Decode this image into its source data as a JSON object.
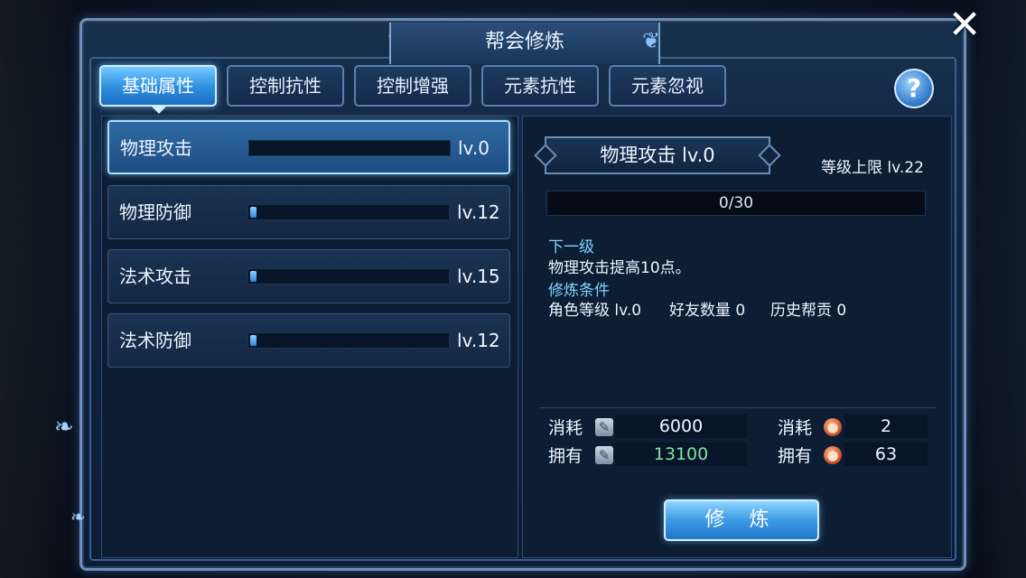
{
  "dialog": {
    "title": "帮会修炼",
    "close": "✕",
    "help": "?"
  },
  "tabs": [
    {
      "label": "基础属性",
      "active": true
    },
    {
      "label": "控制抗性",
      "active": false
    },
    {
      "label": "控制增强",
      "active": false
    },
    {
      "label": "元素抗性",
      "active": false
    },
    {
      "label": "元素忽视",
      "active": false
    }
  ],
  "attributes": [
    {
      "name": "物理攻击",
      "level": "lv.0",
      "selected": true,
      "fill": 0
    },
    {
      "name": "物理防御",
      "level": "lv.12",
      "selected": false,
      "fill": 0.03
    },
    {
      "name": "法术攻击",
      "level": "lv.15",
      "selected": false,
      "fill": 0.03
    },
    {
      "name": "法术防御",
      "level": "lv.12",
      "selected": false,
      "fill": 0.03
    }
  ],
  "detail": {
    "title": "物理攻击   lv.0",
    "level_cap": "等级上限 lv.22",
    "progress": "0/30",
    "progress_fraction": 0,
    "next_head": "下一级",
    "next_body": "物理攻击提高10点。",
    "cond_head": "修炼条件",
    "cond_role": "角色等级 lv.0",
    "cond_friends": "好友数量 0",
    "cond_history": "历史帮贡 0"
  },
  "costs": {
    "consume_label": "消耗",
    "own_label": "拥有",
    "scroll_consume": "6000",
    "scroll_own": "13100",
    "coin_consume": "2",
    "coin_own": "63"
  },
  "train_button": "修 炼"
}
